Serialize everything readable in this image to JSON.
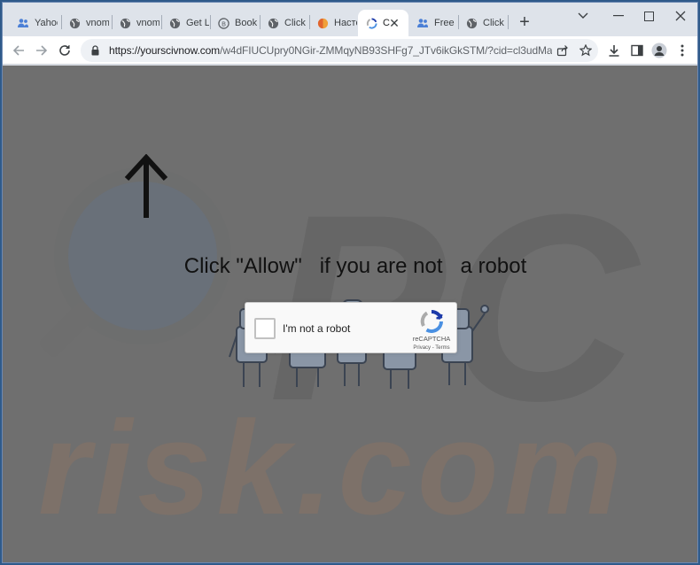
{
  "browser": {
    "tabs": [
      {
        "label": "Yahoo",
        "icon": "people-icon",
        "active": false
      },
      {
        "label": "vnom",
        "icon": "globe-icon",
        "active": false
      },
      {
        "label": "vnom",
        "icon": "globe-icon",
        "active": false
      },
      {
        "label": "Get L",
        "icon": "globe-icon",
        "active": false
      },
      {
        "label": "Book",
        "icon": "bitcoin-icon",
        "active": false
      },
      {
        "label": "Click",
        "icon": "globe-icon",
        "active": false
      },
      {
        "label": "Насто",
        "icon": "orange-circle-icon",
        "active": false
      },
      {
        "label": "C",
        "icon": "recaptcha-icon",
        "active": true
      },
      {
        "label": "Free",
        "icon": "people-icon",
        "active": false
      },
      {
        "label": "Click",
        "icon": "globe-icon",
        "active": false
      }
    ],
    "url_domain": "https://yourscivnow.com",
    "url_path": "/w4dFIUCUpry0NGir-ZMMqyNB93SHFg7_JTv6ikGkSTM/?cid=cl3udMa2UVZ..."
  },
  "page": {
    "headline": "Click \"Allow\"   if you are not   a robot",
    "watermark": "risk.com",
    "watermark_logo": "PC"
  },
  "captcha": {
    "label": "I'm not a robot",
    "brand": "reCAPTCHA",
    "links": "Privacy - Terms"
  }
}
